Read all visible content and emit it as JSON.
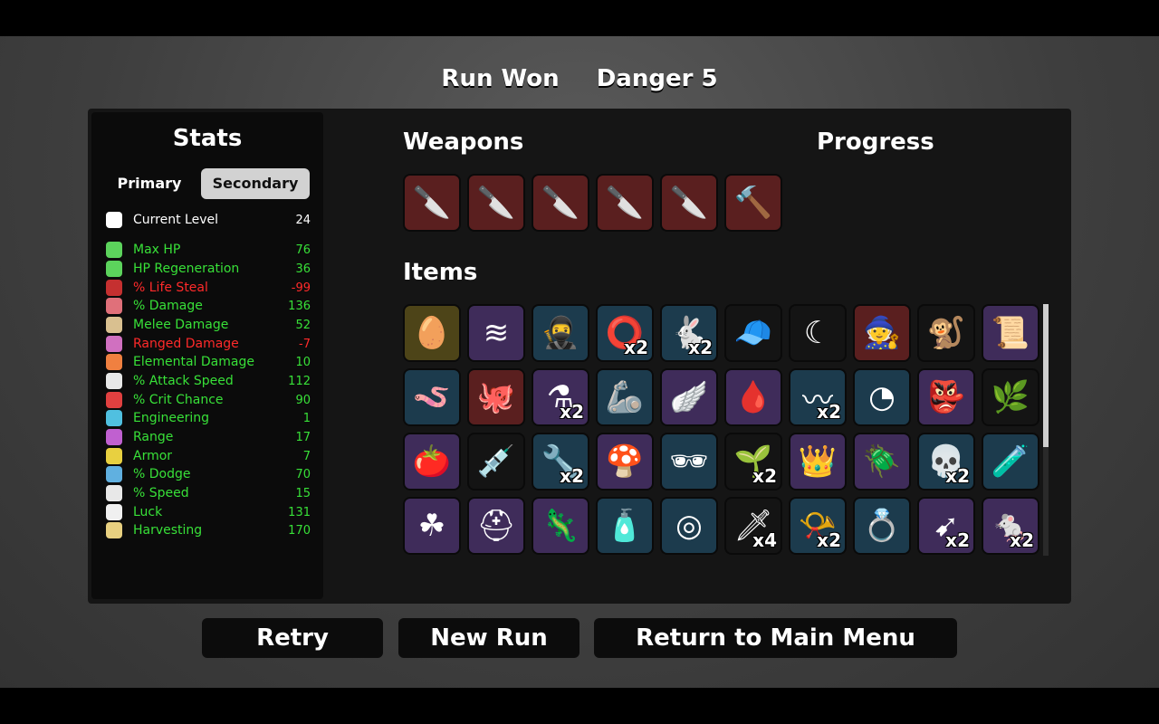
{
  "header": {
    "result": "Run Won",
    "danger": "Danger 5"
  },
  "stats": {
    "title": "Stats",
    "tabs": {
      "primary": "Primary",
      "secondary": "Secondary"
    },
    "rows": [
      {
        "label": "Current Level",
        "value": "24",
        "color": "white",
        "icon": "skull-icon",
        "icon_color": "#ffffff"
      },
      {
        "label": "Max HP",
        "value": "76",
        "color": "green",
        "icon": "heart-icon",
        "icon_color": "#5cd35c"
      },
      {
        "label": "HP Regeneration",
        "value": "36",
        "color": "green",
        "icon": "heart-plus-icon",
        "icon_color": "#5cd35c"
      },
      {
        "label": "% Life Steal",
        "value": "-99",
        "color": "red",
        "icon": "fangs-icon",
        "icon_color": "#c53030"
      },
      {
        "label": "% Damage",
        "value": "136",
        "color": "green",
        "icon": "muscle-icon",
        "icon_color": "#e0707a"
      },
      {
        "label": "Melee Damage",
        "value": "52",
        "color": "green",
        "icon": "sword-icon",
        "icon_color": "#d9c090"
      },
      {
        "label": "Ranged Damage",
        "value": "-7",
        "color": "red",
        "icon": "bow-icon",
        "icon_color": "#d070c0"
      },
      {
        "label": "Elemental Damage",
        "value": "10",
        "color": "green",
        "icon": "flame-icon",
        "icon_color": "#f08040"
      },
      {
        "label": "% Attack Speed",
        "value": "112",
        "color": "green",
        "icon": "hourglass-icon",
        "icon_color": "#e8e8e8"
      },
      {
        "label": "% Crit Chance",
        "value": "90",
        "color": "green",
        "icon": "crit-icon",
        "icon_color": "#e04040"
      },
      {
        "label": "Engineering",
        "value": "1",
        "color": "green",
        "icon": "wrench-icon",
        "icon_color": "#50c0e0"
      },
      {
        "label": "Range",
        "value": "17",
        "color": "green",
        "icon": "range-icon",
        "icon_color": "#c060d0"
      },
      {
        "label": "Armor",
        "value": "7",
        "color": "green",
        "icon": "shield-icon",
        "icon_color": "#e8d040"
      },
      {
        "label": "% Dodge",
        "value": "70",
        "color": "green",
        "icon": "dodge-icon",
        "icon_color": "#60b0e0"
      },
      {
        "label": "% Speed",
        "value": "15",
        "color": "green",
        "icon": "boot-icon",
        "icon_color": "#e8e8e8"
      },
      {
        "label": "Luck",
        "value": "131",
        "color": "green",
        "icon": "dice-icon",
        "icon_color": "#f0f0f0"
      },
      {
        "label": "Harvesting",
        "value": "170",
        "color": "green",
        "icon": "wheat-icon",
        "icon_color": "#e8d080"
      }
    ]
  },
  "weapons": {
    "title": "Weapons",
    "items": [
      {
        "icon": "knife-icon",
        "tier": "red"
      },
      {
        "icon": "knife-icon",
        "tier": "red"
      },
      {
        "icon": "knife-icon",
        "tier": "red"
      },
      {
        "icon": "knife-icon",
        "tier": "red"
      },
      {
        "icon": "knife-icon",
        "tier": "red"
      },
      {
        "icon": "hammer-icon",
        "tier": "red"
      }
    ]
  },
  "progress": {
    "title": "Progress"
  },
  "items": {
    "title": "Items",
    "grid": [
      {
        "icon": "egg-icon",
        "tier": "gold",
        "count": ""
      },
      {
        "icon": "claw-scratch-icon",
        "tier": "purple",
        "count": ""
      },
      {
        "icon": "ninja-icon",
        "tier": "blue",
        "count": ""
      },
      {
        "icon": "red-ring-icon",
        "tier": "blue",
        "count": "x2"
      },
      {
        "icon": "rabbit-icon",
        "tier": "blue",
        "count": "x2"
      },
      {
        "icon": "propeller-hat-icon",
        "tier": "black",
        "count": ""
      },
      {
        "icon": "crescent-icon",
        "tier": "black",
        "count": ""
      },
      {
        "icon": "gnome-icon",
        "tier": "red",
        "count": ""
      },
      {
        "icon": "monkey-icon",
        "tier": "black",
        "count": ""
      },
      {
        "icon": "scroll-icon",
        "tier": "purple",
        "count": ""
      },
      {
        "icon": "worm-icon",
        "tier": "blue",
        "count": ""
      },
      {
        "icon": "octopus-icon",
        "tier": "red",
        "count": ""
      },
      {
        "icon": "mortar-icon",
        "tier": "purple",
        "count": "x2"
      },
      {
        "icon": "robot-arm-icon",
        "tier": "blue",
        "count": ""
      },
      {
        "icon": "wings-icon",
        "tier": "purple",
        "count": ""
      },
      {
        "icon": "blood-bag-icon",
        "tier": "purple",
        "count": ""
      },
      {
        "icon": "tentacle-icon",
        "tier": "blue",
        "count": "x2"
      },
      {
        "icon": "helmet-shard-icon",
        "tier": "blue",
        "count": ""
      },
      {
        "icon": "goblin-icon",
        "tier": "purple",
        "count": ""
      },
      {
        "icon": "moss-icon",
        "tier": "black",
        "count": ""
      },
      {
        "icon": "tomato-icon",
        "tier": "purple",
        "count": ""
      },
      {
        "icon": "syringe-icon",
        "tier": "black",
        "count": ""
      },
      {
        "icon": "alien-wrench-icon",
        "tier": "blue",
        "count": "x2"
      },
      {
        "icon": "mushrooms-icon",
        "tier": "purple",
        "count": ""
      },
      {
        "icon": "glasses-icon",
        "tier": "blue",
        "count": ""
      },
      {
        "icon": "sprout-icon",
        "tier": "black",
        "count": "x2"
      },
      {
        "icon": "crown-icon",
        "tier": "purple",
        "count": ""
      },
      {
        "icon": "alien-bug-icon",
        "tier": "purple",
        "count": ""
      },
      {
        "icon": "alien-skull-icon",
        "tier": "blue",
        "count": "x2"
      },
      {
        "icon": "potion-icon",
        "tier": "blue",
        "count": ""
      },
      {
        "icon": "clover-icon",
        "tier": "purple",
        "count": ""
      },
      {
        "icon": "knight-helm-icon",
        "tier": "purple",
        "count": ""
      },
      {
        "icon": "chameleon-icon",
        "tier": "purple",
        "count": ""
      },
      {
        "icon": "ketchup-icon",
        "tier": "blue",
        "count": ""
      },
      {
        "icon": "crown-ring-icon",
        "tier": "blue",
        "count": ""
      },
      {
        "icon": "dagger-icon",
        "tier": "black",
        "count": "x4"
      },
      {
        "icon": "horn-icon",
        "tier": "blue",
        "count": "x2"
      },
      {
        "icon": "ring-icon",
        "tier": "blue",
        "count": ""
      },
      {
        "icon": "bullet-icon",
        "tier": "purple",
        "count": "x2"
      },
      {
        "icon": "mouse-icon",
        "tier": "purple",
        "count": "x2"
      }
    ]
  },
  "buttons": {
    "retry": "Retry",
    "new_run": "New Run",
    "main_menu": "Return to Main Menu"
  },
  "tier_colors": {
    "red": "#5a1f1f",
    "purple": "#3f2c5a",
    "blue": "#1c3b4d",
    "black": "#141414",
    "gold": "#4d4418"
  },
  "text_colors": {
    "white": "#ffffff",
    "green": "#38e038",
    "red": "#ff2a2a"
  }
}
